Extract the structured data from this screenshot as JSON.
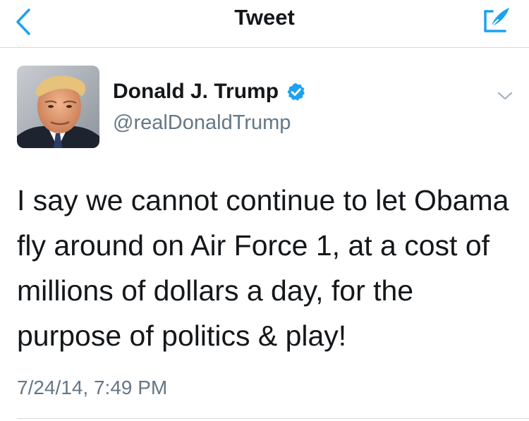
{
  "nav": {
    "title": "Tweet",
    "accent_color": "#1da1f2"
  },
  "tweet": {
    "author": {
      "name": "Donald J. Trump",
      "handle": "@realDonaldTrump",
      "verified": true,
      "avatar_icon": "profile-photo"
    },
    "text": "I say we cannot continue to let Obama fly around on Air Force 1, at a cost of millions of dollars a day, for the purpose of politics & play!",
    "timestamp": "7/24/14, 7:49 PM"
  },
  "colors": {
    "text_primary": "#14171a",
    "text_secondary": "#657786",
    "divider": "#d6d9dc",
    "verified": "#1da1f2"
  }
}
